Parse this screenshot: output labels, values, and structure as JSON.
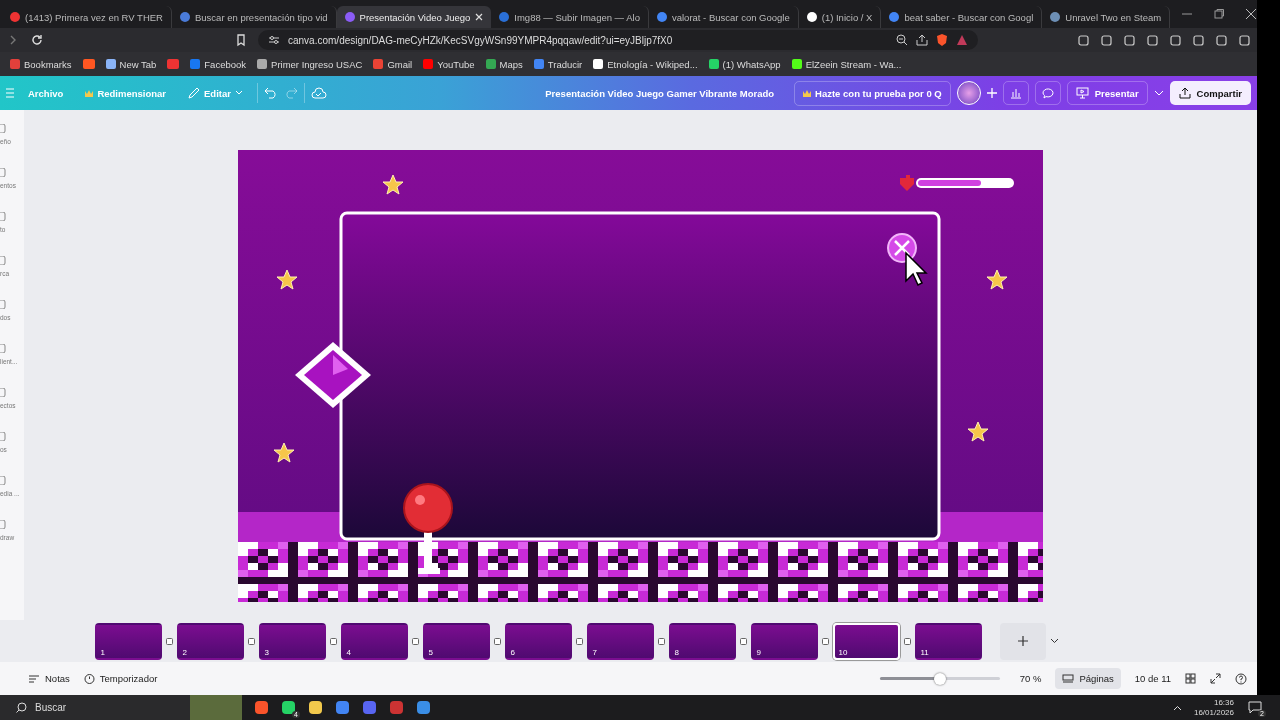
{
  "browser": {
    "tabs": [
      {
        "title": "(1413) Primera vez en RV THER",
        "selected": false
      },
      {
        "title": "Buscar en presentación tipo vid",
        "selected": false
      },
      {
        "title": "Presentación Video Juego",
        "selected": true
      },
      {
        "title": "Img88 — Subir Imagen — Alo",
        "selected": false
      },
      {
        "title": "valorat - Buscar con Google",
        "selected": false
      },
      {
        "title": "(1) Inicio / X",
        "selected": false
      },
      {
        "title": "beat saber - Buscar con Googl",
        "selected": false
      },
      {
        "title": "Unravel Two en Steam",
        "selected": false
      }
    ],
    "url": "canva.com/design/DAG-meCyHZk/KecSVgyWSn99YMPR4pqqaw/edit?ui=eyJBljp7fX0",
    "bookmarks": [
      {
        "kind": "link",
        "label": "Bookmarks"
      },
      {
        "kind": "icon"
      },
      {
        "kind": "link",
        "label": "New Tab"
      },
      {
        "kind": "icon"
      },
      {
        "kind": "link",
        "label": "Facebook"
      },
      {
        "kind": "link",
        "label": "Primer Ingreso USAC"
      },
      {
        "kind": "link",
        "label": "Gmail"
      },
      {
        "kind": "link",
        "label": "YouTube"
      },
      {
        "kind": "link",
        "label": "Maps"
      },
      {
        "kind": "link",
        "label": "Traducir"
      },
      {
        "kind": "link",
        "label": "Etnología - Wikiped..."
      },
      {
        "kind": "link",
        "label": "(1) WhatsApp"
      },
      {
        "kind": "link",
        "label": "ElZeein Stream - Wa..."
      }
    ]
  },
  "canva": {
    "menu": [
      "Archivo",
      "Redimensionar",
      "Editar"
    ],
    "title": "Presentación Video Juego Gamer Vibrante Morado",
    "trial": "Hazte con tu prueba por 0 Q",
    "present": "Presentar",
    "share": "Compartir"
  },
  "sidebar": {
    "items": [
      "eño",
      "entos",
      "to",
      "rca",
      "dos",
      "lient...",
      "ectos",
      "os",
      "edia ...",
      "draw"
    ]
  },
  "pages": [
    {
      "number": "1",
      "selected": false
    },
    {
      "number": "2",
      "selected": false
    },
    {
      "number": "3",
      "selected": false
    },
    {
      "number": "4",
      "selected": false
    },
    {
      "number": "5",
      "selected": false
    },
    {
      "number": "6",
      "selected": false
    },
    {
      "number": "7",
      "selected": false
    },
    {
      "number": "8",
      "selected": false
    },
    {
      "number": "9",
      "selected": false
    },
    {
      "number": "10",
      "selected": true
    },
    {
      "number": "11",
      "selected": false
    }
  ],
  "status": {
    "notes": "Notas",
    "timer": "Temporizador",
    "zoom": {
      "level": 0.5,
      "reading": "70 %"
    },
    "pages_button": "Páginas",
    "page_count": "10 de 11"
  },
  "taskbar": {
    "search": {
      "placeholder": "Buscar"
    },
    "whatsapp_badge": "4",
    "time": "16:36",
    "date": "16/01/2026",
    "notification_count": "2"
  }
}
